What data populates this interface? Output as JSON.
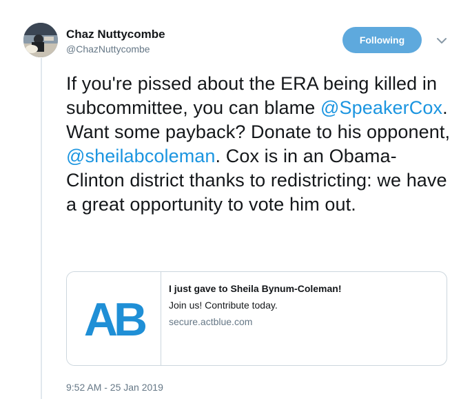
{
  "author": {
    "name": "Chaz Nuttycombe",
    "handle": "@ChazNuttycombe"
  },
  "follow_button": {
    "label": "Following"
  },
  "tweet": {
    "seg1": "If you're pissed about the ERA being killed in subcommittee, you can blame ",
    "mention1": "@SpeakerCox",
    "seg2": ". Want some payback? Donate to his opponent, ",
    "mention2": "@sheilabcoleman",
    "seg3": ". Cox is in an Obama-Clinton district thanks to redistricting: we have a great opportunity to vote him out."
  },
  "card": {
    "logo_text": "AB",
    "title": "I just gave to Sheila Bynum-Coleman!",
    "description": "Join us! Contribute today.",
    "domain": "secure.actblue.com"
  },
  "timestamp": "9:52 AM - 25 Jan 2019",
  "colors": {
    "accent": "#1b95e0",
    "button": "#5ea9dd",
    "actblue": "#1f8fd6",
    "muted": "#657786"
  }
}
